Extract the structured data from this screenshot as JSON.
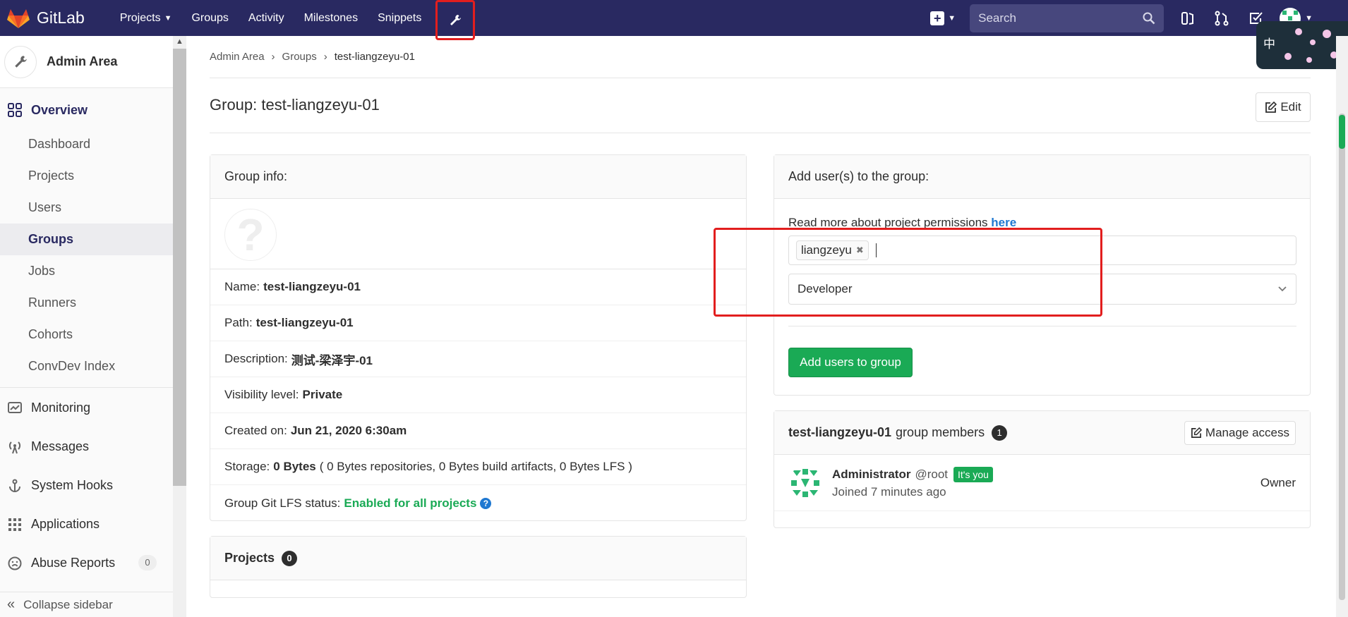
{
  "navbar": {
    "brand": "GitLab",
    "links": [
      "Projects",
      "Groups",
      "Activity",
      "Milestones",
      "Snippets"
    ],
    "search_placeholder": "Search",
    "ime_char": "中"
  },
  "sidebar": {
    "header": "Admin Area",
    "overview": "Overview",
    "overview_items": [
      "Dashboard",
      "Projects",
      "Users",
      "Groups",
      "Jobs",
      "Runners",
      "Cohorts",
      "ConvDev Index"
    ],
    "other_items": [
      "Monitoring",
      "Messages",
      "System Hooks",
      "Applications",
      "Abuse Reports"
    ],
    "abuse_count": "0",
    "collapse": "Collapse sidebar"
  },
  "breadcrumb": [
    "Admin Area",
    "Groups",
    "test-liangzeyu-01"
  ],
  "page": {
    "title": "Group: test-liangzeyu-01",
    "edit": "Edit"
  },
  "info": {
    "heading": "Group info:",
    "name_label": "Name:",
    "name_value": "test-liangzeyu-01",
    "path_label": "Path:",
    "path_value": "test-liangzeyu-01",
    "desc_label": "Description:",
    "desc_value": "测试-梁泽宇-01",
    "vis_label": "Visibility level:",
    "vis_value": "Private",
    "created_label": "Created on:",
    "created_value": "Jun 21, 2020 6:30am",
    "storage_label": "Storage:",
    "storage_value": "0 Bytes",
    "storage_detail": "( 0 Bytes repositories, 0 Bytes build artifacts, 0 Bytes LFS )",
    "lfs_label": "Group Git LFS status:",
    "lfs_value": "Enabled for all projects"
  },
  "projects": {
    "heading": "Projects",
    "count": "0"
  },
  "add_users": {
    "heading": "Add user(s) to the group:",
    "perm_text": "Read more about project permissions",
    "perm_link": "here",
    "token": "liangzeyu",
    "role": "Developer",
    "button": "Add users to group"
  },
  "members": {
    "group": "test-liangzeyu-01",
    "label": "group members",
    "count": "1",
    "manage": "Manage access",
    "list": [
      {
        "name": "Administrator",
        "handle": "@root",
        "badge": "It's you",
        "joined": "Joined 7 minutes ago",
        "role": "Owner"
      }
    ]
  }
}
